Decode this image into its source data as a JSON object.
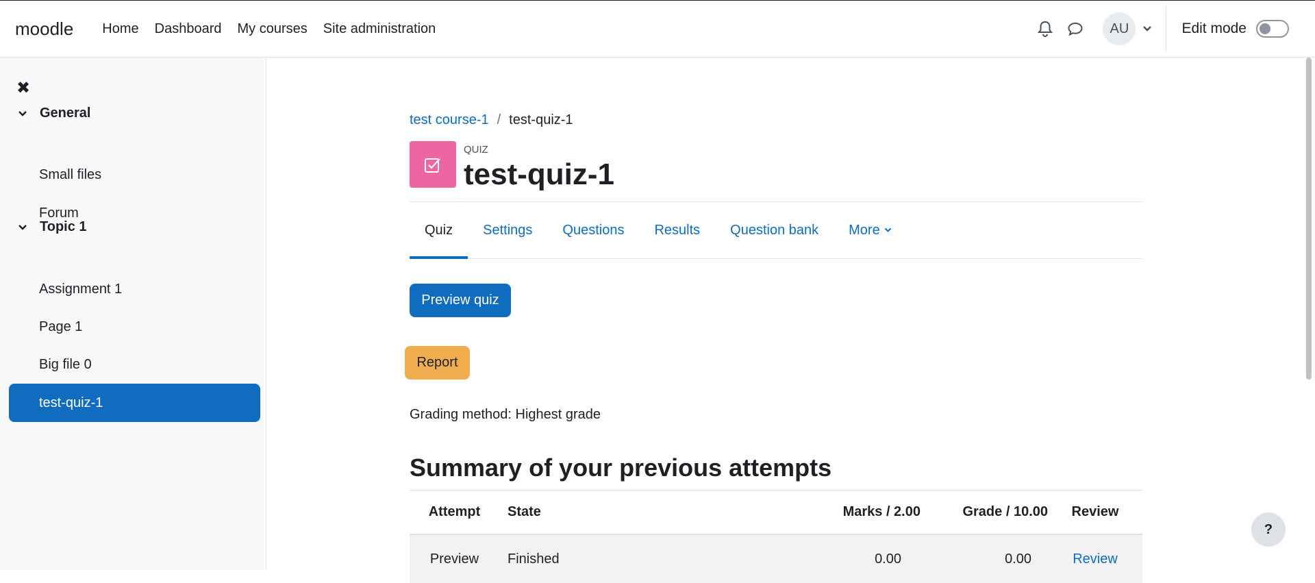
{
  "header": {
    "brand": "moodle",
    "nav": [
      "Home",
      "Dashboard",
      "My courses",
      "Site administration"
    ],
    "avatar_initials": "AU",
    "edit_mode_label": "Edit mode",
    "edit_mode_on": false
  },
  "drawer": {
    "close_icon": "close-icon",
    "sections": [
      {
        "label": "General",
        "items": [
          "Small files",
          "Forum"
        ]
      },
      {
        "label": "Topic 1",
        "items": [
          "Assignment 1",
          "Page 1",
          "Big file 0",
          "test-quiz-1"
        ]
      }
    ],
    "active_item": "test-quiz-1"
  },
  "breadcrumb": {
    "course": "test course-1",
    "sep": "/",
    "current": "test-quiz-1"
  },
  "activity": {
    "type": "QUIZ",
    "title": "test-quiz-1",
    "icon_color": "#eb66a2"
  },
  "tabs": [
    "Quiz",
    "Settings",
    "Questions",
    "Results",
    "Question bank",
    "More"
  ],
  "active_tab": "Quiz",
  "buttons": {
    "preview": "Preview quiz",
    "report": "Report"
  },
  "grading_method": "Grading method: Highest grade",
  "summary_heading": "Summary of your previous attempts",
  "attempts_table": {
    "columns": [
      "Attempt",
      "State",
      "Marks / 2.00",
      "Grade / 10.00",
      "Review"
    ],
    "rows": [
      [
        "Preview",
        "Finished",
        "0.00",
        "0.00",
        "Review"
      ]
    ]
  },
  "help_label": "?",
  "colors": {
    "primary": "#0f6cbf",
    "warning": "#f0ad4e",
    "quiz_icon": "#eb66a2"
  }
}
